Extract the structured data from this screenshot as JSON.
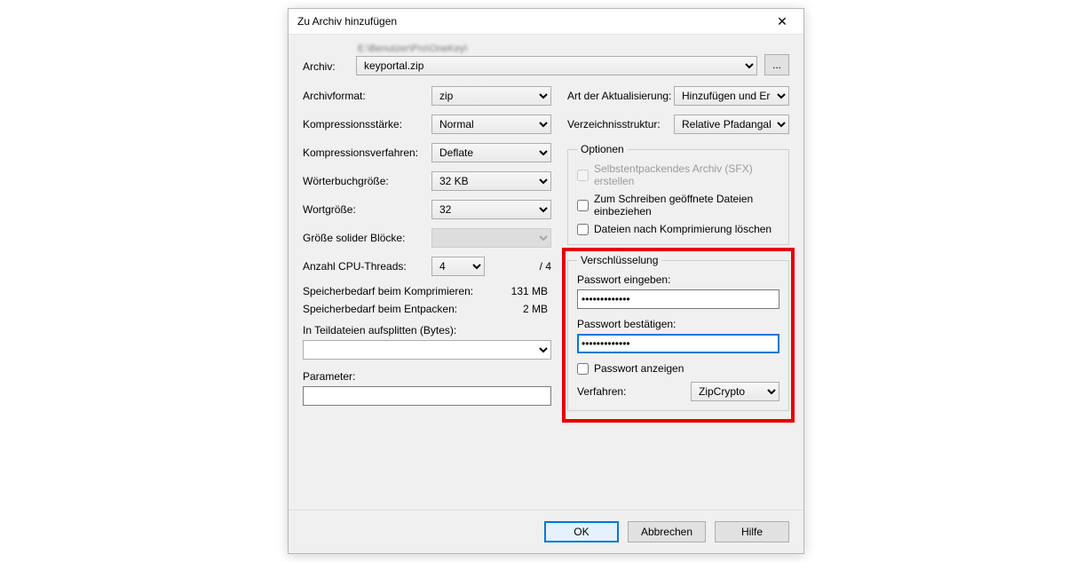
{
  "window": {
    "title": "Zu Archiv hinzufügen"
  },
  "archive": {
    "label": "Archiv:",
    "path_blurred": "E:\\Benutzer\\Pro\\OneKey\\",
    "filename": "keyportal.zip",
    "browse": "..."
  },
  "left": {
    "format_label": "Archivformat:",
    "format_value": "zip",
    "level_label": "Kompressionsstärke:",
    "level_value": "Normal",
    "method_label": "Kompressionsverfahren:",
    "method_value": "Deflate",
    "dict_label": "Wörterbuchgröße:",
    "dict_value": "32 KB",
    "word_label": "Wortgröße:",
    "word_value": "32",
    "solid_label": "Größe solider Blöcke:",
    "solid_value": "",
    "cpu_label": "Anzahl CPU-Threads:",
    "cpu_value": "4",
    "cpu_max": "/ 4",
    "mem_compress_label": "Speicherbedarf beim Komprimieren:",
    "mem_compress_value": "131 MB",
    "mem_decompress_label": "Speicherbedarf beim Entpacken:",
    "mem_decompress_value": "2 MB",
    "split_label": "In Teildateien aufsplitten (Bytes):",
    "split_value": "",
    "params_label": "Parameter:",
    "params_value": ""
  },
  "right": {
    "update_label": "Art der Aktualisierung:",
    "update_value": "Hinzufügen und Ersetzen",
    "pathmode_label": "Verzeichnisstruktur:",
    "pathmode_value": "Relative Pfadangaben",
    "options_legend": "Optionen",
    "opt_sfx": "Selbstentpackendes Archiv (SFX) erstellen",
    "opt_shared": "Zum Schreiben geöffnete Dateien einbeziehen",
    "opt_delete": "Dateien nach Komprimierung löschen",
    "enc_legend": "Verschlüsselung",
    "enc_pw_label": "Passwort eingeben:",
    "enc_pw_value": "•••••••••••••",
    "enc_pw2_label": "Passwort bestätigen:",
    "enc_pw2_value": "•••••••••••••",
    "enc_show": "Passwort anzeigen",
    "enc_method_label": "Verfahren:",
    "enc_method_value": "ZipCrypto"
  },
  "footer": {
    "ok": "OK",
    "cancel": "Abbrechen",
    "help": "Hilfe"
  }
}
